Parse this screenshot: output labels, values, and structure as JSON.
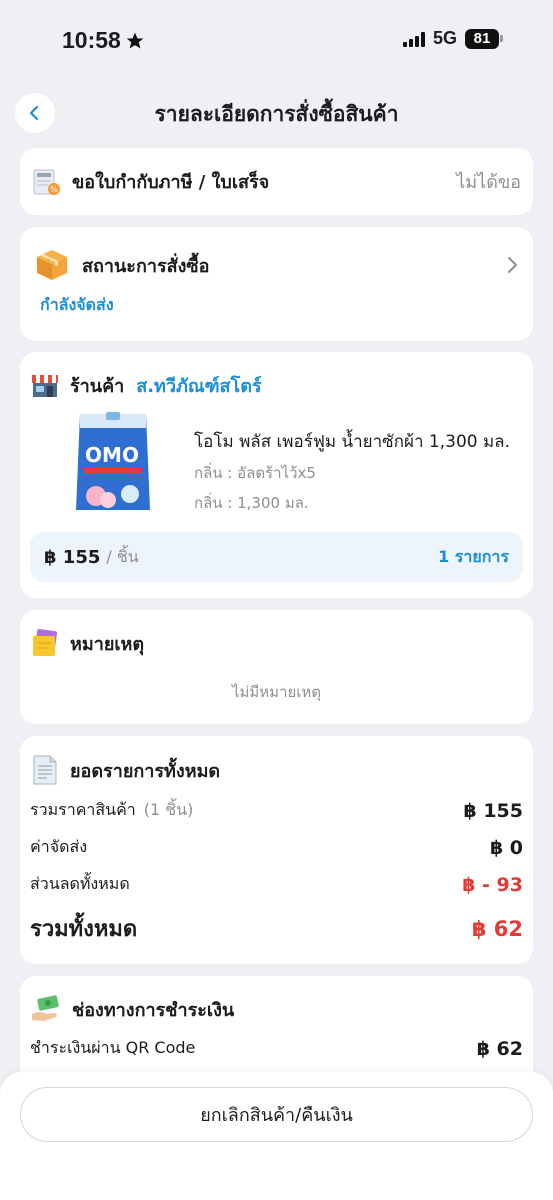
{
  "status_bar": {
    "time": "10:58",
    "network": "5G",
    "battery": "81"
  },
  "header": {
    "title": "รายละเอียดการสั่งซื้อสินค้า"
  },
  "tax_invoice": {
    "label": "ขอใบกำกับภาษี / ใบเสร็จ",
    "value": "ไม่ได้ขอ"
  },
  "order_status": {
    "title": "สถานะการสั่งซื้อ",
    "status": "กำลังจัดส่ง"
  },
  "shop": {
    "label": "ร้านค้า",
    "name": "ส.ทวีภัณฑ์สโตร์",
    "product": {
      "name": "โอโม พลัส เพอร์ฟูม น้ำยาซักผ้า 1,300 มล.",
      "attr1": "กลิ่น : อัลตร้าไว้x5",
      "attr2": "กลิ่น : 1,300 มล."
    },
    "price": "฿ 155",
    "per_unit": "/ ชิ้น",
    "items_count": "1 รายการ"
  },
  "note": {
    "title": "หมายเหตุ",
    "empty": "ไม่มีหมายเหตุ"
  },
  "summary": {
    "title": "ยอดรายการทั้งหมด",
    "subtotal_label": "รวมราคาสินค้า",
    "subtotal_qty": "(1 ชิ้น)",
    "subtotal_value": "฿ 155",
    "shipping_label": "ค่าจัดส่ง",
    "shipping_value": "฿ 0",
    "discount_label": "ส่วนลดทั้งหมด",
    "discount_value": "฿ - 93",
    "total_label": "รวมทั้งหมด",
    "total_value": "฿ 62"
  },
  "payment": {
    "title": "ช่องทางการชำระเงิน",
    "method": "ชำระเงินผ่าน QR Code",
    "amount": "฿ 62"
  },
  "footer": {
    "cancel_label": "ยกเลิกสินค้า/คืนเงิน"
  },
  "colors": {
    "accent": "#1a8fd6",
    "discount": "#e53935",
    "background": "#eef0f3"
  }
}
